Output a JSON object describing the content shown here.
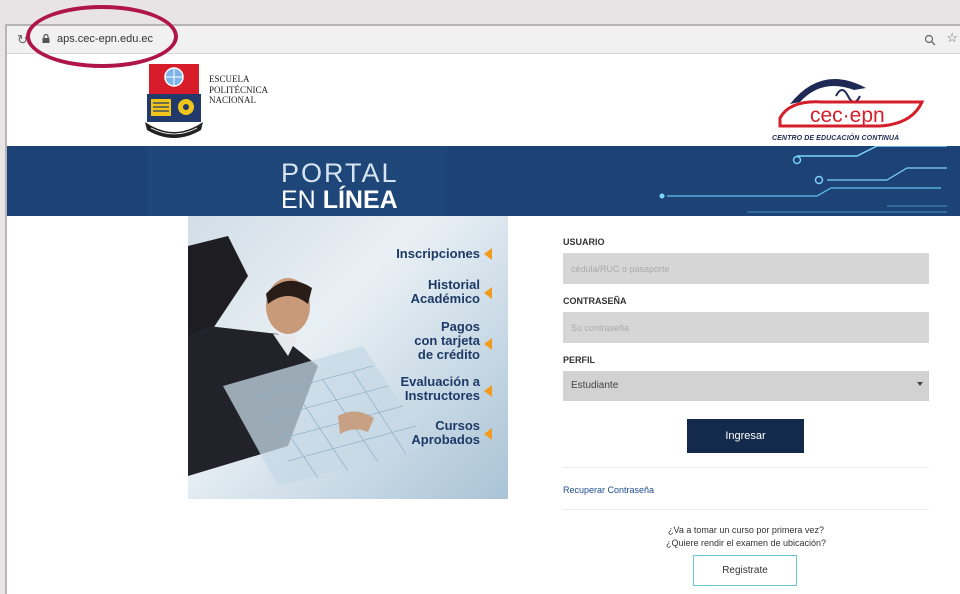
{
  "browser": {
    "url": "aps.cec-epn.edu.ec"
  },
  "header": {
    "epn_name": [
      "ESCUELA",
      "POLITÉCNICA",
      "NACIONAL"
    ],
    "cec_logo_text": "cec·epn",
    "cec_caption": "CENTRO DE EDUCACIÓN CONTINUA"
  },
  "banner": {
    "line1": "PORTAL",
    "line2_prefix": "EN ",
    "line2_bold": "LÍNEA"
  },
  "promo": {
    "items": [
      {
        "lines": [
          "Inscripciones"
        ]
      },
      {
        "lines": [
          "Historial",
          "Académico"
        ]
      },
      {
        "lines": [
          "Pagos",
          "con tarjeta",
          "de crédito"
        ]
      },
      {
        "lines": [
          "Evaluación a",
          "Instructores"
        ]
      },
      {
        "lines": [
          "Cursos",
          "Aprobados"
        ]
      }
    ]
  },
  "form": {
    "usuario_label": "USUARIO",
    "usuario_placeholder": "cédula/RUC o pasaporte",
    "password_label": "CONTRASEÑA",
    "password_placeholder": "Su contraseña",
    "perfil_label": "PERFIL",
    "perfil_value": "Estudiante",
    "submit_label": "Ingresar",
    "recover_label": "Recuperar Contraseña",
    "first_time_q1": "¿Va a tomar un curso por primera vez?",
    "first_time_q2": "¿Quiere rendir el examen de ubicación?",
    "register_label": "Registrate"
  },
  "colors": {
    "banner": "#1d4275",
    "button": "#142a4c",
    "accent_arrow": "#f29a1d",
    "annotation": "#b0154a"
  }
}
